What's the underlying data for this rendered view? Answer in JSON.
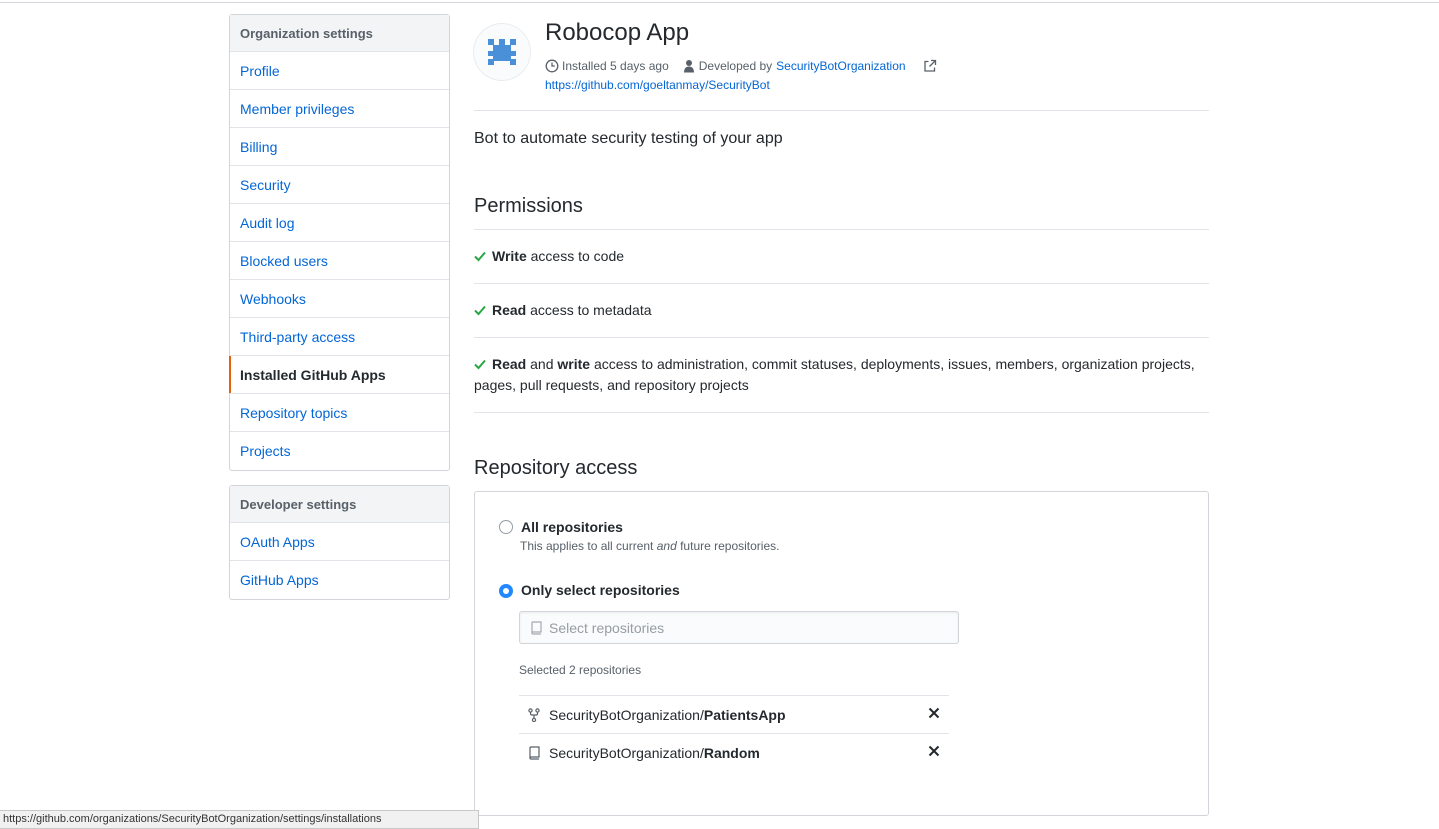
{
  "sidebar": {
    "org_heading": "Organization settings",
    "org_items": [
      {
        "label": "Profile"
      },
      {
        "label": "Member privileges"
      },
      {
        "label": "Billing"
      },
      {
        "label": "Security"
      },
      {
        "label": "Audit log"
      },
      {
        "label": "Blocked users"
      },
      {
        "label": "Webhooks"
      },
      {
        "label": "Third-party access"
      },
      {
        "label": "Installed GitHub Apps",
        "selected": true
      },
      {
        "label": "Repository topics"
      },
      {
        "label": "Projects"
      }
    ],
    "dev_heading": "Developer settings",
    "dev_items": [
      {
        "label": "OAuth Apps"
      },
      {
        "label": "GitHub Apps"
      }
    ]
  },
  "app": {
    "name": "Robocop App",
    "installed": "Installed 5 days ago",
    "developed_by_prefix": "Developed by",
    "developer": "SecurityBotOrganization",
    "repo_url": "https://github.com/goeltanmay/SecurityBot",
    "description": "Bot to automate security testing of your app"
  },
  "permissions": {
    "title": "Permissions",
    "items": [
      {
        "strong1": "Write",
        "rest1": " access to code"
      },
      {
        "strong1": "Read",
        "rest1": " access to metadata"
      },
      {
        "strong1": "Read",
        "mid": " and ",
        "strong2": "write",
        "rest2": " access to administration, commit statuses, deployments, issues, members, organization projects, pages, pull requests, and repository projects"
      }
    ]
  },
  "repository_access": {
    "title": "Repository access",
    "all_label": "All repositories",
    "all_note_before": "This applies to all current ",
    "all_note_em": "and",
    "all_note_after": " future repositories.",
    "select_label": "Only select repositories",
    "search_placeholder": "Select repositories",
    "selected_count": "Selected 2 repositories",
    "repos": [
      {
        "owner": "SecurityBotOrganization/",
        "name": "PatientsApp",
        "icon": "fork-icon"
      },
      {
        "owner": "SecurityBotOrganization/",
        "name": "Random",
        "icon": "repo-icon"
      }
    ]
  },
  "status_bar": {
    "url": "https://github.com/organizations/SecurityBotOrganization/settings/installations"
  },
  "colors": {
    "link": "#0366d6",
    "selected_accent": "#e36209",
    "check_green": "#28a745",
    "radio_blue": "#2188ff",
    "logo_blue": "#4a90d9"
  }
}
